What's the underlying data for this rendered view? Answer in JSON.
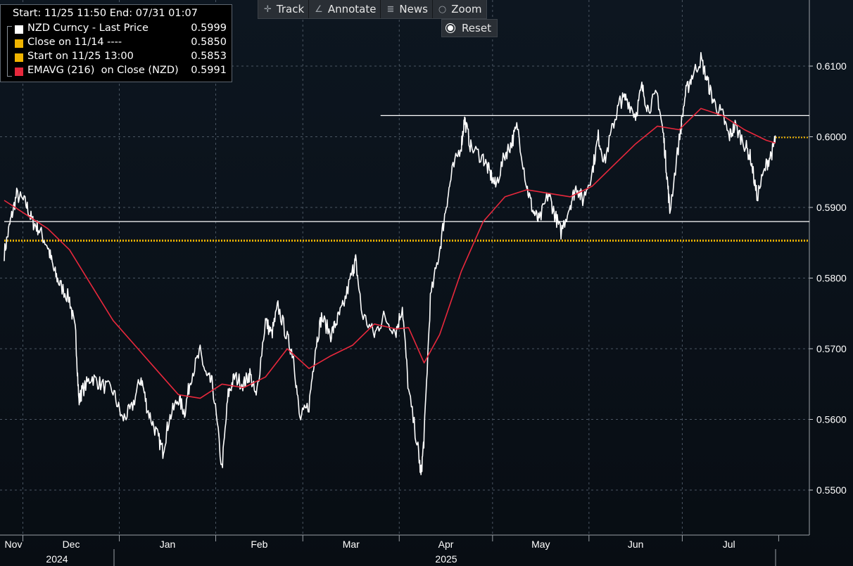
{
  "legend": {
    "header": "Start: 11/25 11:50 End: 07/31 01:07",
    "rows": [
      {
        "label": "NZD Curncy - Last Price",
        "value": "0.5999",
        "color": "#ffffff"
      },
      {
        "label": "Close on 11/14 ----",
        "value": "0.5850",
        "color": "#f0b400"
      },
      {
        "label": "Start on 11/25 13:00",
        "value": "0.5853",
        "color": "#f0b400"
      },
      {
        "label": "EMAVG (216)  on Close (NZD)",
        "value": "0.5991",
        "color": "#e8283c"
      }
    ]
  },
  "toolbar": {
    "buttons": [
      {
        "label": "Track",
        "icon": "crosshair-icon"
      },
      {
        "label": "Annotate",
        "icon": "pencil-icon"
      },
      {
        "label": "News",
        "icon": "news-icon"
      },
      {
        "label": "Zoom",
        "icon": "magnifier-icon"
      }
    ],
    "reset_label": "Reset"
  },
  "chart_data": {
    "type": "line",
    "ylim": [
      0.5445,
      0.6145
    ],
    "y_ticks": [
      "0.6100",
      "0.6000",
      "0.5900",
      "0.5800",
      "0.5700",
      "0.5600",
      "0.5500"
    ],
    "months": [
      "Nov",
      "Dec",
      "Jan",
      "Feb",
      "Mar",
      "Apr",
      "May",
      "Jun",
      "Jul"
    ],
    "years": [
      "2024",
      "2025"
    ],
    "x_start": "2024-11-25",
    "x_end": "2025-07-31",
    "grid": true,
    "legend_position": "top-left",
    "series": [
      {
        "name": "NZD Curncy - Last Price",
        "color": "#ffffff",
        "points": [
          [
            "2024-11-25",
            0.5835
          ],
          [
            "2024-11-27",
            0.588
          ],
          [
            "2024-11-29",
            0.5918
          ],
          [
            "2024-12-02",
            0.5905
          ],
          [
            "2024-12-04",
            0.588
          ],
          [
            "2024-12-06",
            0.587
          ],
          [
            "2024-12-09",
            0.5845
          ],
          [
            "2024-12-11",
            0.581
          ],
          [
            "2024-12-13",
            0.579
          ],
          [
            "2024-12-16",
            0.577
          ],
          [
            "2024-12-18",
            0.572
          ],
          [
            "2024-12-19",
            0.5625
          ],
          [
            "2024-12-20",
            0.564
          ],
          [
            "2024-12-23",
            0.566
          ],
          [
            "2024-12-26",
            0.565
          ],
          [
            "2024-12-30",
            0.564
          ],
          [
            "2025-01-02",
            0.56
          ],
          [
            "2025-01-05",
            0.5615
          ],
          [
            "2025-01-08",
            0.566
          ],
          [
            "2025-01-10",
            0.5615
          ],
          [
            "2025-01-13",
            0.558
          ],
          [
            "2025-01-15",
            0.5555
          ],
          [
            "2025-01-17",
            0.56
          ],
          [
            "2025-01-20",
            0.563
          ],
          [
            "2025-01-22",
            0.561
          ],
          [
            "2025-01-24",
            0.566
          ],
          [
            "2025-01-27",
            0.5695
          ],
          [
            "2025-01-29",
            0.566
          ],
          [
            "2025-01-31",
            0.565
          ],
          [
            "2025-02-03",
            0.553
          ],
          [
            "2025-02-05",
            0.5635
          ],
          [
            "2025-02-07",
            0.566
          ],
          [
            "2025-02-10",
            0.565
          ],
          [
            "2025-02-12",
            0.5665
          ],
          [
            "2025-02-14",
            0.563
          ],
          [
            "2025-02-17",
            0.574
          ],
          [
            "2025-02-19",
            0.572
          ],
          [
            "2025-02-21",
            0.576
          ],
          [
            "2025-02-24",
            0.5715
          ],
          [
            "2025-02-26",
            0.569
          ],
          [
            "2025-02-28",
            0.56
          ],
          [
            "2025-03-03",
            0.562
          ],
          [
            "2025-03-05",
            0.57
          ],
          [
            "2025-03-07",
            0.5745
          ],
          [
            "2025-03-10",
            0.572
          ],
          [
            "2025-03-12",
            0.574
          ],
          [
            "2025-03-14",
            0.576
          ],
          [
            "2025-03-17",
            0.581
          ],
          [
            "2025-03-18",
            0.5825
          ],
          [
            "2025-03-20",
            0.575
          ],
          [
            "2025-03-24",
            0.572
          ],
          [
            "2025-03-27",
            0.5745
          ],
          [
            "2025-03-31",
            0.5725
          ],
          [
            "2025-04-02",
            0.576
          ],
          [
            "2025-04-04",
            0.564
          ],
          [
            "2025-04-07",
            0.556
          ],
          [
            "2025-04-08",
            0.552
          ],
          [
            "2025-04-09",
            0.5575
          ],
          [
            "2025-04-11",
            0.577
          ],
          [
            "2025-04-14",
            0.584
          ],
          [
            "2025-04-16",
            0.59
          ],
          [
            "2025-04-18",
            0.595
          ],
          [
            "2025-04-21",
            0.599
          ],
          [
            "2025-04-22",
            0.6025
          ],
          [
            "2025-04-24",
            0.5985
          ],
          [
            "2025-04-28",
            0.597
          ],
          [
            "2025-04-30",
            0.595
          ],
          [
            "2025-05-02",
            0.593
          ],
          [
            "2025-05-05",
            0.5975
          ],
          [
            "2025-05-07",
            0.599
          ],
          [
            "2025-05-09",
            0.6015
          ],
          [
            "2025-05-12",
            0.593
          ],
          [
            "2025-05-14",
            0.5895
          ],
          [
            "2025-05-16",
            0.588
          ],
          [
            "2025-05-19",
            0.592
          ],
          [
            "2025-05-21",
            0.589
          ],
          [
            "2025-05-23",
            0.5865
          ],
          [
            "2025-05-26",
            0.5905
          ],
          [
            "2025-05-28",
            0.593
          ],
          [
            "2025-05-30",
            0.591
          ],
          [
            "2025-06-02",
            0.595
          ],
          [
            "2025-06-04",
            0.6
          ],
          [
            "2025-06-06",
            0.5965
          ],
          [
            "2025-06-09",
            0.602
          ],
          [
            "2025-06-11",
            0.605
          ],
          [
            "2025-06-13",
            0.6055
          ],
          [
            "2025-06-16",
            0.603
          ],
          [
            "2025-06-18",
            0.607
          ],
          [
            "2025-06-20",
            0.604
          ],
          [
            "2025-06-23",
            0.606
          ],
          [
            "2025-06-25",
            0.6
          ],
          [
            "2025-06-26",
            0.595
          ],
          [
            "2025-06-27",
            0.5895
          ],
          [
            "2025-06-30",
            0.5995
          ],
          [
            "2025-07-02",
            0.606
          ],
          [
            "2025-07-04",
            0.6085
          ],
          [
            "2025-07-07",
            0.611
          ],
          [
            "2025-07-09",
            0.608
          ],
          [
            "2025-07-11",
            0.605
          ],
          [
            "2025-07-14",
            0.603
          ],
          [
            "2025-07-16",
            0.6
          ],
          [
            "2025-07-18",
            0.6015
          ],
          [
            "2025-07-21",
            0.599
          ],
          [
            "2025-07-23",
            0.597
          ],
          [
            "2025-07-25",
            0.5915
          ],
          [
            "2025-07-28",
            0.596
          ],
          [
            "2025-07-30",
            0.598
          ],
          [
            "2025-07-31",
            0.5999
          ]
        ]
      },
      {
        "name": "EMAVG (216)  on Close (NZD)",
        "color": "#e8283c",
        "points": [
          [
            "2024-11-25",
            0.591
          ],
          [
            "2024-12-02",
            0.589
          ],
          [
            "2024-12-09",
            0.587
          ],
          [
            "2024-12-16",
            0.584
          ],
          [
            "2024-12-23",
            0.579
          ],
          [
            "2024-12-30",
            0.574
          ],
          [
            "2025-01-06",
            0.5705
          ],
          [
            "2025-01-13",
            0.567
          ],
          [
            "2025-01-20",
            0.5635
          ],
          [
            "2025-01-27",
            0.563
          ],
          [
            "2025-02-03",
            0.565
          ],
          [
            "2025-02-10",
            0.5645
          ],
          [
            "2025-02-17",
            0.566
          ],
          [
            "2025-02-24",
            0.57
          ],
          [
            "2025-03-03",
            0.5672
          ],
          [
            "2025-03-10",
            0.569
          ],
          [
            "2025-03-17",
            0.5705
          ],
          [
            "2025-03-24",
            0.5735
          ],
          [
            "2025-03-31",
            0.5728
          ],
          [
            "2025-04-04",
            0.573
          ],
          [
            "2025-04-09",
            0.568
          ],
          [
            "2025-04-14",
            0.572
          ],
          [
            "2025-04-21",
            0.581
          ],
          [
            "2025-04-28",
            0.588
          ],
          [
            "2025-05-05",
            0.5915
          ],
          [
            "2025-05-12",
            0.5925
          ],
          [
            "2025-05-19",
            0.592
          ],
          [
            "2025-05-26",
            0.5915
          ],
          [
            "2025-06-02",
            0.593
          ],
          [
            "2025-06-09",
            0.596
          ],
          [
            "2025-06-16",
            0.599
          ],
          [
            "2025-06-23",
            0.6015
          ],
          [
            "2025-06-30",
            0.601
          ],
          [
            "2025-07-07",
            0.604
          ],
          [
            "2025-07-14",
            0.603
          ],
          [
            "2025-07-21",
            0.601
          ],
          [
            "2025-07-28",
            0.5995
          ],
          [
            "2025-07-31",
            0.5991
          ]
        ]
      }
    ],
    "reference_lines": [
      {
        "value": 0.588,
        "color": "#ffffff",
        "from": "2024-11-25",
        "to": "2025-07-31"
      },
      {
        "value": 0.603,
        "color": "#ffffff",
        "from": "2025-03-26",
        "to": "2025-07-31"
      },
      {
        "value": 0.5853,
        "color": "#f0b400",
        "style": "dotted",
        "from": "2024-11-25",
        "to": "2025-07-31"
      }
    ],
    "last_price_marker": {
      "value": 0.5999,
      "color": "#f0b400"
    }
  }
}
